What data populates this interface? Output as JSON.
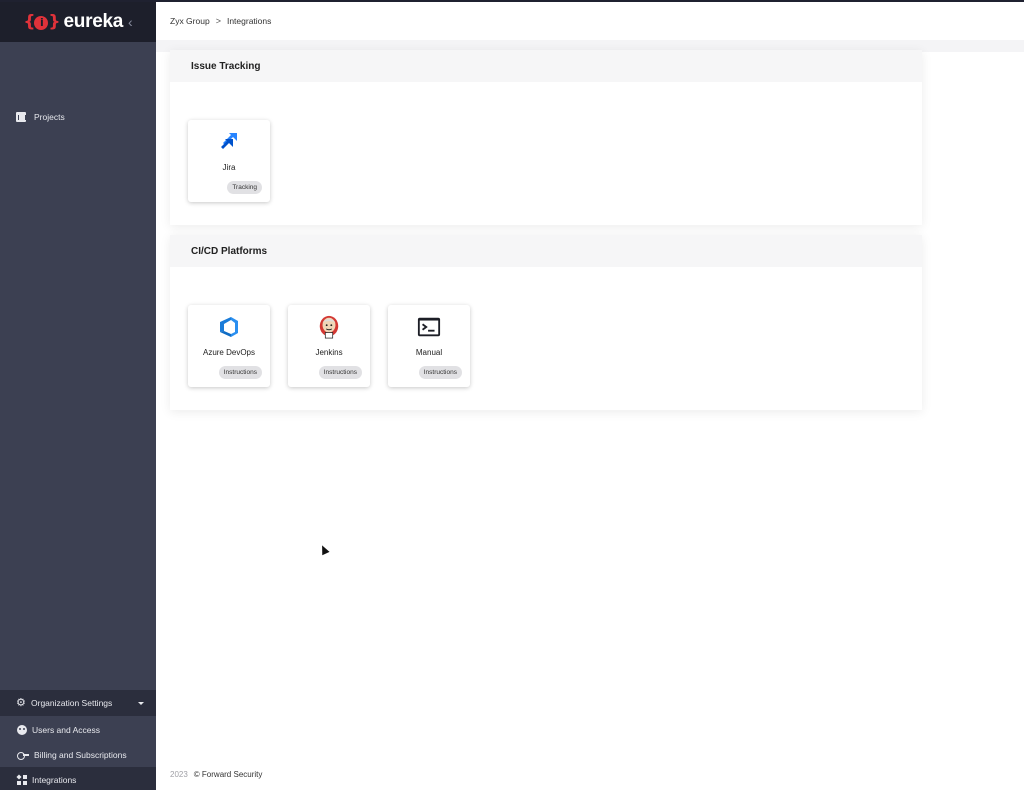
{
  "brand": {
    "logo_mark": "{",
    "logo_i": "i",
    "logo_mark_close": "}",
    "logo_text": "eureka",
    "collapse_glyph": "‹",
    "accent": "#e0323a"
  },
  "sidebar": {
    "projects": {
      "label": "Projects",
      "icon": "bar-chart-icon"
    },
    "org_settings": {
      "label": "Organization Settings",
      "icon": "gear-icon"
    },
    "sub_items": [
      {
        "label": "Users and Access",
        "icon": "users-icon"
      },
      {
        "label": "Billing and Subscriptions",
        "icon": "key-icon"
      },
      {
        "label": "Integrations",
        "icon": "puzzle-icon",
        "active": true
      }
    ]
  },
  "breadcrumb": {
    "parent": "Zyx Group",
    "separator": ">",
    "current": "Integrations"
  },
  "sections": [
    {
      "title": "Issue Tracking",
      "cards": [
        {
          "name": "Jira",
          "chip": "Tracking",
          "icon": "jira-icon"
        }
      ]
    },
    {
      "title": "CI/CD Platforms",
      "cards": [
        {
          "name": "Azure DevOps",
          "chip": "Instructions",
          "icon": "azure-devops-icon"
        },
        {
          "name": "Jenkins",
          "chip": "Instructions",
          "icon": "jenkins-icon"
        },
        {
          "name": "Manual",
          "chip": "Instructions",
          "icon": "terminal-icon"
        }
      ]
    }
  ],
  "footer": {
    "year": "2023",
    "copyright": "© Forward Security"
  }
}
